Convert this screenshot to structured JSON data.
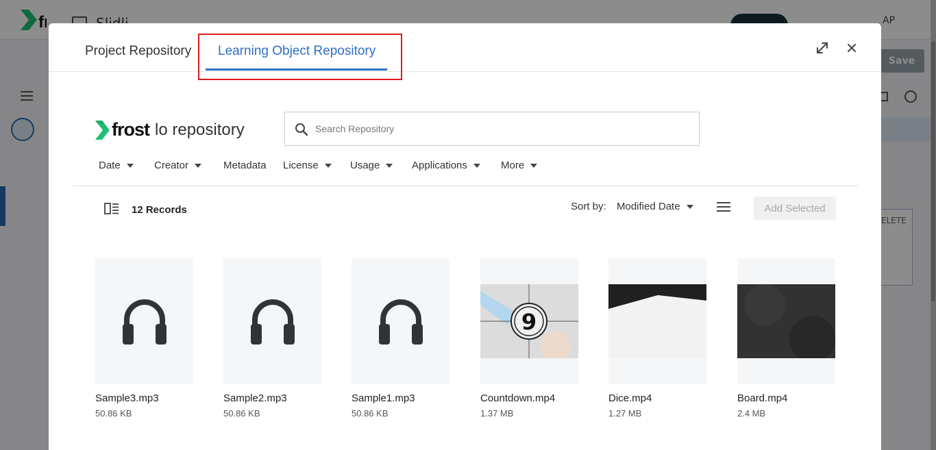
{
  "background": {
    "app_title": "Slidli",
    "user_initials": "AP",
    "save_label": "Save",
    "delete_label": "ELETE"
  },
  "tabs": [
    {
      "label": "Project Repository",
      "active": false
    },
    {
      "label": "Learning Object Repository",
      "active": true
    }
  ],
  "window_controls": {
    "expand_icon": "expand-icon",
    "close_icon": "close-icon"
  },
  "brand": {
    "word": "frost",
    "subtitle": "lo repository"
  },
  "search": {
    "placeholder": "Search Repository",
    "value": ""
  },
  "filters": [
    {
      "label": "Date",
      "has_caret": true
    },
    {
      "label": "Creator",
      "has_caret": true
    },
    {
      "label": "Metadata",
      "has_caret": false
    },
    {
      "label": "License",
      "has_caret": true
    },
    {
      "label": "Usage",
      "has_caret": true
    },
    {
      "label": "Applications",
      "has_caret": true
    },
    {
      "label": "More",
      "has_caret": true
    }
  ],
  "toolbar": {
    "records_label": "12 Records",
    "sort_label": "Sort by:",
    "sort_value": "Modified Date",
    "add_selected_label": "Add Selected"
  },
  "files": [
    {
      "name": "Sample3.mp3",
      "size": "50.86 KB",
      "kind": "audio",
      "icon": "headphones-icon"
    },
    {
      "name": "Sample2.mp3",
      "size": "50.86 KB",
      "kind": "audio",
      "icon": "headphones-icon"
    },
    {
      "name": "Sample1.mp3",
      "size": "50.86 KB",
      "kind": "audio",
      "icon": "headphones-icon"
    },
    {
      "name": "Countdown.mp4",
      "size": "1.37 MB",
      "kind": "video",
      "thumb_text": "9"
    },
    {
      "name": "Dice.mp4",
      "size": "1.27 MB",
      "kind": "video"
    },
    {
      "name": "Board.mp4",
      "size": "2.4 MB",
      "kind": "video"
    }
  ],
  "colors": {
    "accent": "#2f6fc4",
    "highlight_box": "#e01b1b",
    "brand_green": "#1fbf73"
  }
}
